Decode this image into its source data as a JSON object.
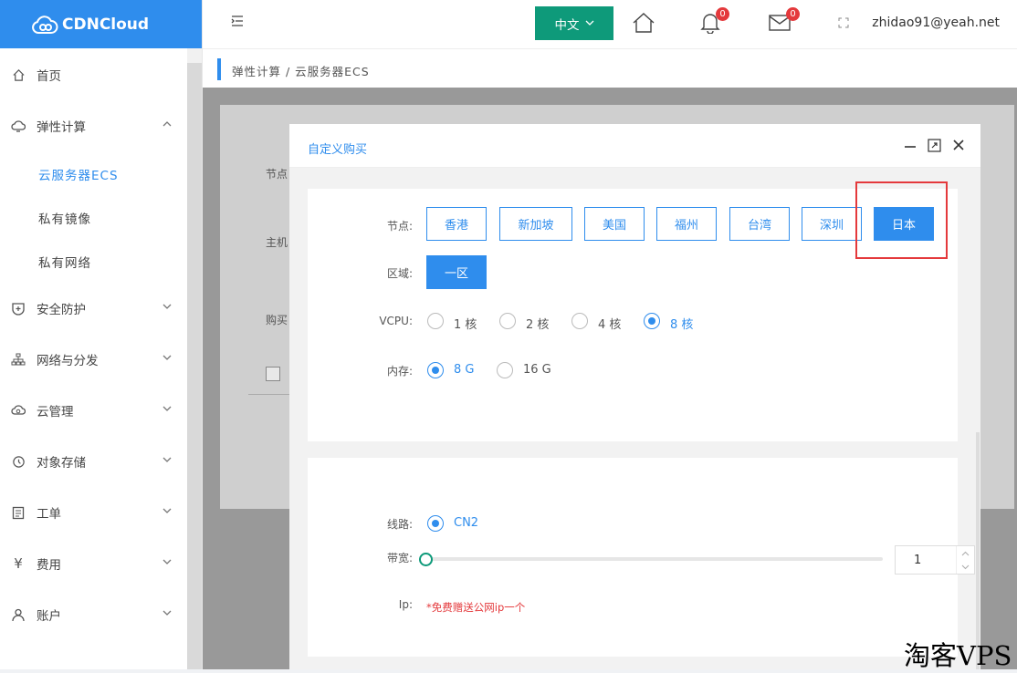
{
  "brand": {
    "name": "CDNCloud",
    "color": "#2f8ded"
  },
  "sidebar": {
    "items": [
      {
        "label": "首页",
        "icon": "home-icon"
      },
      {
        "label": "弹性计算",
        "icon": "cloud-compute-icon",
        "expanded": true,
        "children": [
          {
            "label": "云服务器ECS",
            "active": true
          },
          {
            "label": "私有镜像"
          },
          {
            "label": "私有网络"
          }
        ]
      },
      {
        "label": "安全防护",
        "icon": "shield-icon"
      },
      {
        "label": "网络与分发",
        "icon": "network-icon"
      },
      {
        "label": "云管理",
        "icon": "cloud-manage-icon"
      },
      {
        "label": "对象存储",
        "icon": "storage-icon"
      },
      {
        "label": "工单",
        "icon": "ticket-icon"
      },
      {
        "label": "费用",
        "icon": "yen-icon"
      },
      {
        "label": "账户",
        "icon": "user-icon"
      }
    ]
  },
  "header": {
    "menu_icon": "menu-fold-icon",
    "language": "中文",
    "notifications_count": "0",
    "messages_count": "0",
    "user_email": "zhidao91@yeah.net"
  },
  "breadcrumb": "弹性计算 / 云服务器ECS",
  "background_form": {
    "labels": [
      "节点",
      "主机",
      "购买"
    ]
  },
  "modal": {
    "title": "自定义购买",
    "node_label": "节点:",
    "nodes": [
      "香港",
      "新加坡",
      "美国",
      "福州",
      "台湾",
      "深圳",
      "日本"
    ],
    "selected_node": "日本",
    "zone_label": "区域:",
    "zone_value": "一区",
    "vcpu_label": "VCPU:",
    "vcpu_options": [
      "1 核",
      "2 核",
      "4 核",
      "8 核"
    ],
    "vcpu_selected": "8 核",
    "memory_label": "内存:",
    "memory_options": [
      "8 G",
      "16 G"
    ],
    "memory_selected": "8 G",
    "line_label": "线路:",
    "line_value": "CN2",
    "bandwidth_label": "带宽:",
    "bandwidth_value": "1",
    "ip_label": "Ip:",
    "ip_note": "*免费赠送公网ip一个"
  },
  "watermark": "淘客VPS",
  "colors": {
    "accent": "#2f8ded",
    "lang_button": "#0e9a7a",
    "badge": "#e4393c",
    "highlight": "#e4393c"
  }
}
